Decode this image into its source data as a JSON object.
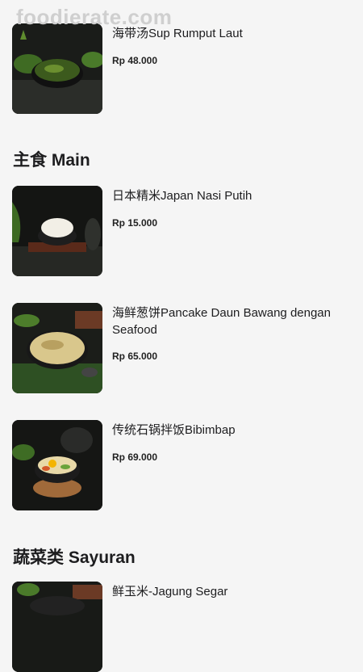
{
  "watermark": "foodierate.com",
  "sections": {
    "main": {
      "title": "主食 Main"
    },
    "veg": {
      "title": "蔬菜类 Sayuran"
    }
  },
  "items": [
    {
      "name": "海带汤Sup Rumput Laut",
      "price": "Rp 48.000",
      "photo_icon": "seaweed-soup-photo"
    },
    {
      "name": "日本精米Japan Nasi Putih",
      "price": "Rp 15.000",
      "photo_icon": "rice-bowl-photo"
    },
    {
      "name": "海鲜葱饼Pancake Daun Bawang dengan Seafood",
      "price": "Rp 65.000",
      "photo_icon": "pancake-photo"
    },
    {
      "name": "传统石锅拌饭Bibimbap",
      "price": "Rp 69.000",
      "photo_icon": "bibimbap-photo"
    },
    {
      "name": "鲜玉米-Jagung Segar",
      "price": "",
      "photo_icon": "corn-photo"
    }
  ]
}
